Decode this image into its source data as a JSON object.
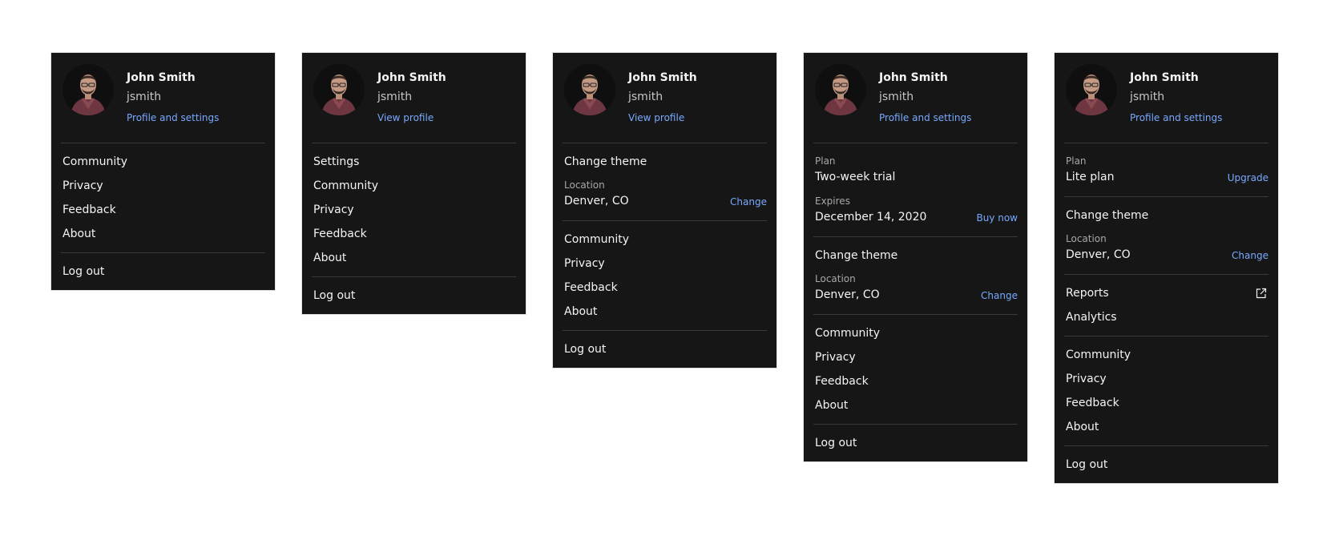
{
  "user": {
    "name": "John Smith",
    "handle": "jsmith"
  },
  "menus": [
    {
      "profile_link": "Profile and settings",
      "links": [
        "Community",
        "Privacy",
        "Feedback",
        "About"
      ],
      "logout": "Log out"
    },
    {
      "profile_link": "View profile",
      "links": [
        "Settings",
        "Community",
        "Privacy",
        "Feedback",
        "About"
      ],
      "logout": "Log out"
    },
    {
      "profile_link": "View profile",
      "change_theme": "Change theme",
      "location": {
        "label": "Location",
        "value": "Denver, CO",
        "action": "Change"
      },
      "links": [
        "Community",
        "Privacy",
        "Feedback",
        "About"
      ],
      "logout": "Log out"
    },
    {
      "profile_link": "Profile and settings",
      "plan": {
        "label": "Plan",
        "value": "Two-week trial"
      },
      "expires": {
        "label": "Expires",
        "value": "December 14, 2020",
        "action": "Buy now"
      },
      "change_theme": "Change theme",
      "location": {
        "label": "Location",
        "value": "Denver, CO",
        "action": "Change"
      },
      "links": [
        "Community",
        "Privacy",
        "Feedback",
        "About"
      ],
      "logout": "Log out"
    },
    {
      "profile_link": "Profile and settings",
      "plan": {
        "label": "Plan",
        "value": "Lite plan",
        "action": "Upgrade"
      },
      "change_theme": "Change theme",
      "location": {
        "label": "Location",
        "value": "Denver, CO",
        "action": "Change"
      },
      "tools": [
        {
          "label": "Reports",
          "icon": "external-link-icon"
        },
        {
          "label": "Analytics"
        }
      ],
      "links": [
        "Community",
        "Privacy",
        "Feedback",
        "About"
      ],
      "logout": "Log out"
    }
  ],
  "colors": {
    "panel_bg": "#161616",
    "text": "#f4f4f4",
    "link": "#78a9ff",
    "divider": "#393939"
  }
}
